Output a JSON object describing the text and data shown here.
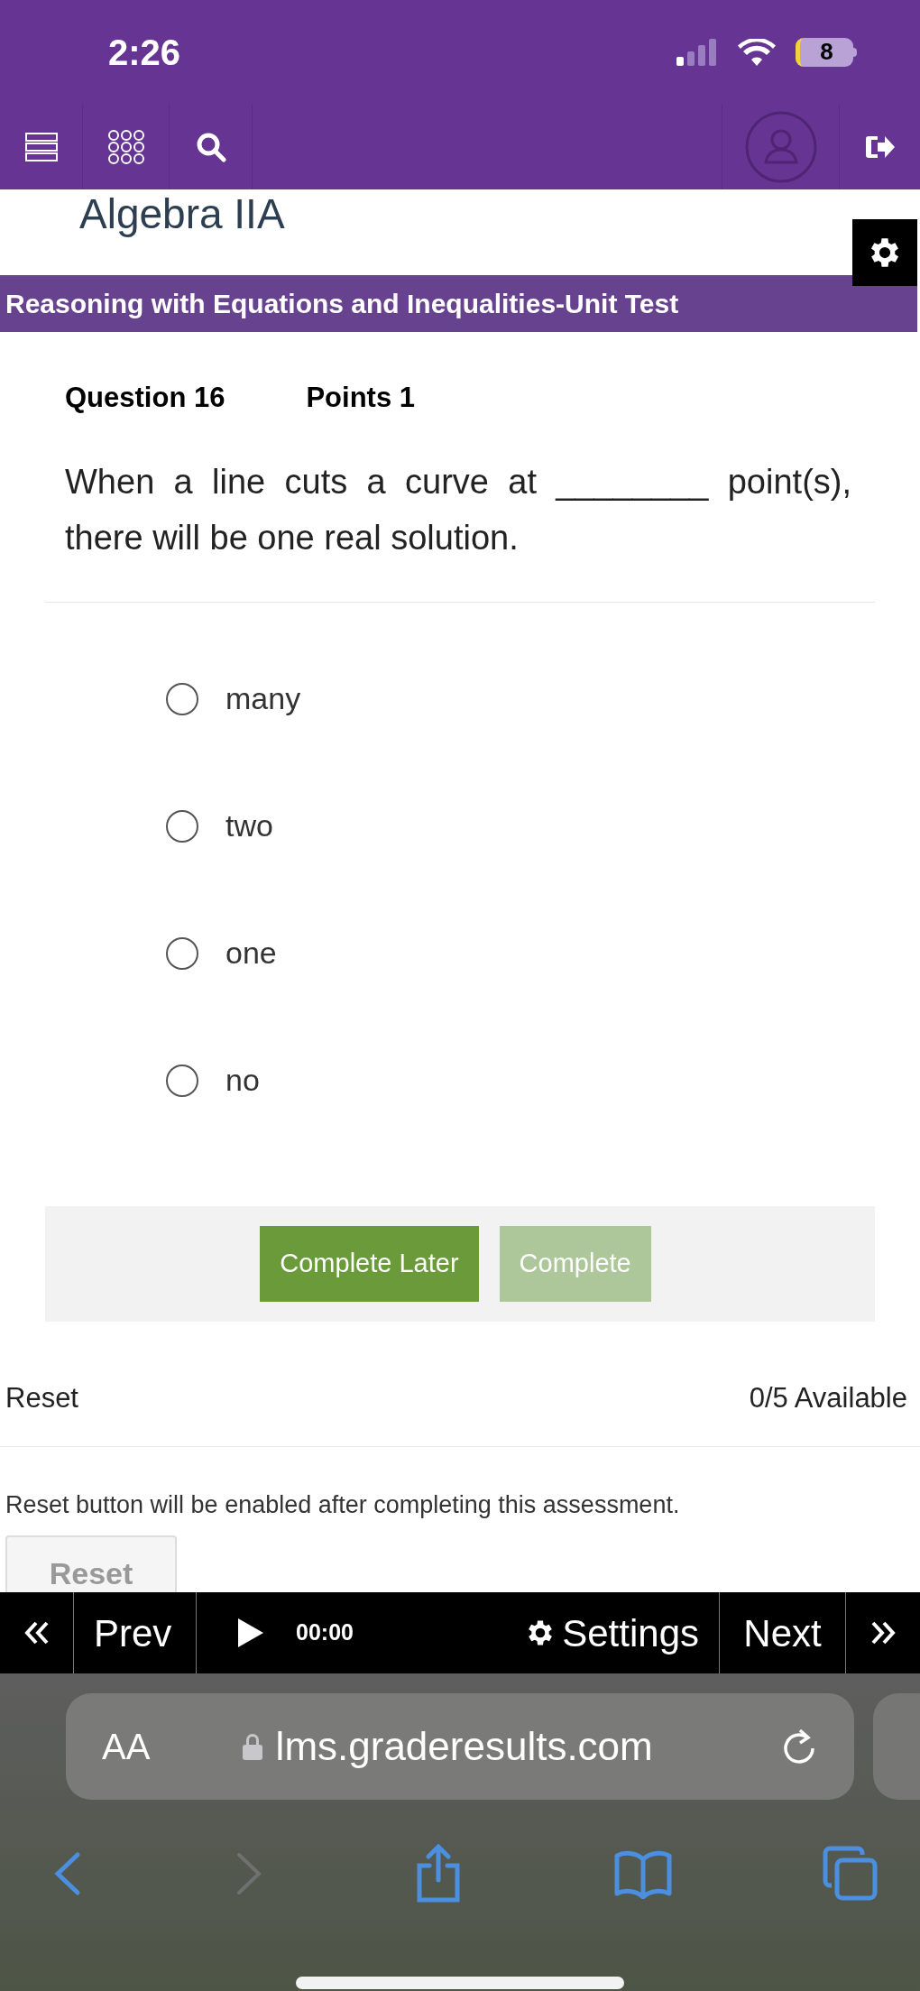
{
  "status_bar": {
    "time": "2:26",
    "battery": "8"
  },
  "course": {
    "title": "Algebra IIA"
  },
  "banner": {
    "title": "Reasoning with Equations and Inequalities-Unit Test"
  },
  "question": {
    "number": "Question 16",
    "points": "Points 1",
    "text": "When a line cuts a curve at ________ point(s), there will be one real solution."
  },
  "options": [
    {
      "label": "many",
      "selected": false
    },
    {
      "label": "two",
      "selected": false
    },
    {
      "label": "one",
      "selected": false
    },
    {
      "label": "no",
      "selected": false
    }
  ],
  "actions": [
    {
      "label": "Complete Later",
      "disabled": false
    },
    {
      "label": "Complete",
      "disabled": true
    }
  ],
  "reset": {
    "label": "Reset",
    "available": "0/5 Available",
    "note": "Reset button will be enabled after completing this assessment.",
    "button": "Reset",
    "disabled": true
  },
  "player": {
    "prev": "Prev",
    "time": "00:00",
    "settings": "Settings",
    "next": "Next"
  },
  "browser": {
    "text_size": "AA",
    "url": "lms.graderesults.com"
  }
}
